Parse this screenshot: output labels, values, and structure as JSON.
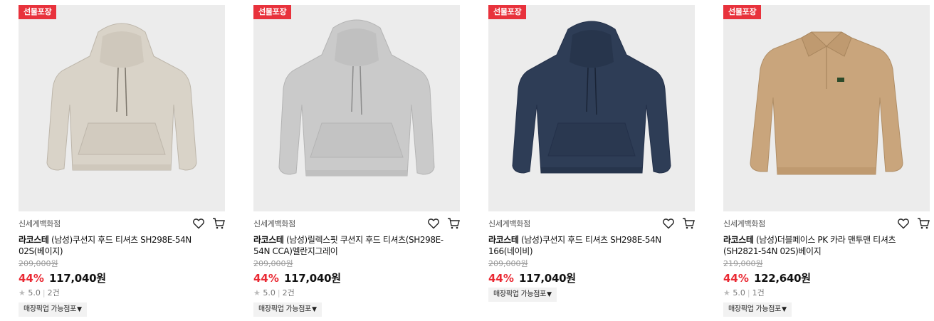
{
  "products": [
    {
      "badge": "선물포장",
      "store": "신세계백화점",
      "brand": "라코스테",
      "name": " (남성)쿠션지 후드 티셔츠 SH298E-54N 02S(베이지)",
      "original_price": "209,000원",
      "discount": "44%",
      "price": "117,040원",
      "rating": "5.0",
      "reviews": "2건",
      "pickup": "매장픽업 가능점포",
      "garment": "hoodie",
      "color": "#d9d3c8"
    },
    {
      "badge": "선물포장",
      "store": "신세계백화점",
      "brand": "라코스테",
      "name": " (남성)릴렉스핏 쿠션지 후드 티셔츠(SH298E-54N CCA)멜란지그레이",
      "original_price": "209,000원",
      "discount": "44%",
      "price": "117,040원",
      "rating": "5.0",
      "reviews": "2건",
      "pickup": "매장픽업 가능점포",
      "garment": "hoodie",
      "color": "#cacaca"
    },
    {
      "badge": "선물포장",
      "store": "신세계백화점",
      "brand": "라코스테",
      "name": " (남성)쿠션지 후드 티셔츠 SH298E-54N 166(네이비)",
      "original_price": "209,000원",
      "discount": "44%",
      "price": "117,040원",
      "rating": "",
      "reviews": "",
      "pickup": "매장픽업 가능점포",
      "garment": "hoodie",
      "color": "#2e3d56"
    },
    {
      "badge": "선물포장",
      "store": "신세계백화점",
      "brand": "라코스테",
      "name": " (남성)더블페이스 PK 카라 맨투맨 티셔츠(SH2821-54N 02S)베이지",
      "original_price": "219,000원",
      "discount": "44%",
      "price": "122,640원",
      "rating": "5.0",
      "reviews": "1건",
      "pickup": "매장픽업 가능점포",
      "garment": "polo",
      "color": "#c9a57c"
    }
  ],
  "icons": {
    "wishlist": "heart-icon",
    "cart": "cart-icon",
    "rating": "star-icon",
    "dropdown": "caret-down-icon"
  },
  "colors": {
    "badge": "#e8323c",
    "discount": "#ea2a34"
  }
}
